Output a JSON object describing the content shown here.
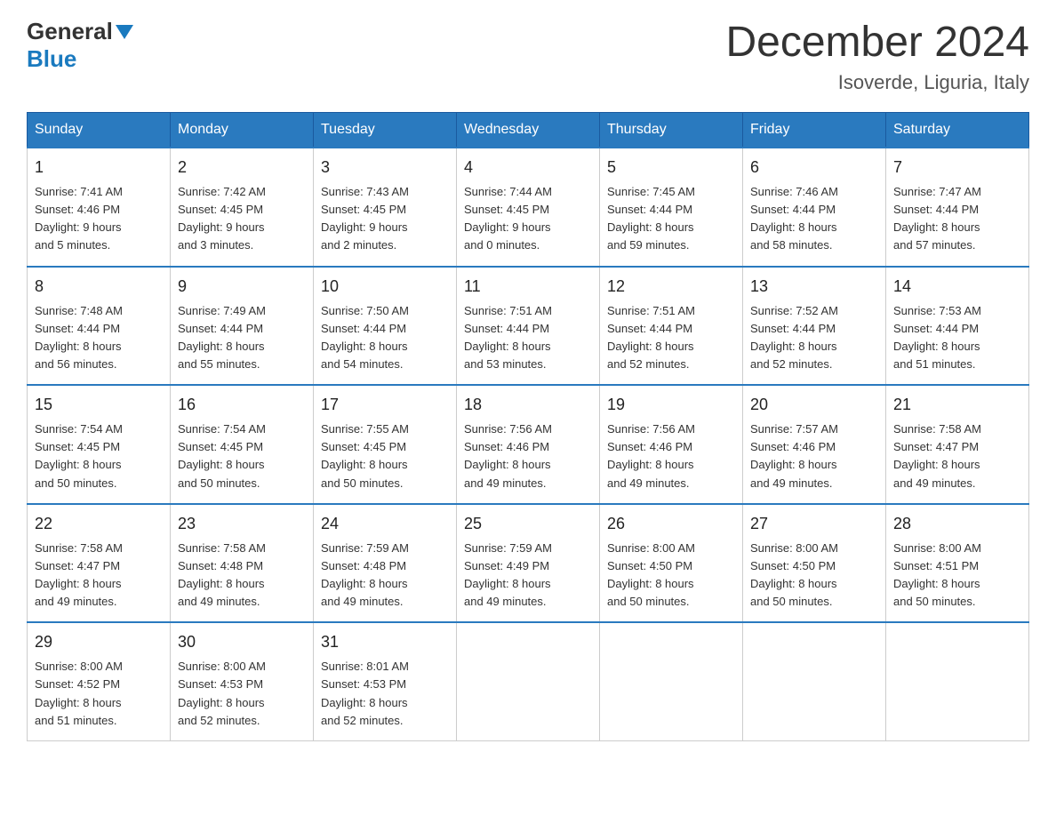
{
  "header": {
    "logo_general": "General",
    "logo_blue": "Blue",
    "title": "December 2024",
    "subtitle": "Isoverde, Liguria, Italy"
  },
  "days_of_week": [
    "Sunday",
    "Monday",
    "Tuesday",
    "Wednesday",
    "Thursday",
    "Friday",
    "Saturday"
  ],
  "weeks": [
    [
      {
        "day": "1",
        "sunrise": "7:41 AM",
        "sunset": "4:46 PM",
        "daylight": "9 hours and 5 minutes."
      },
      {
        "day": "2",
        "sunrise": "7:42 AM",
        "sunset": "4:45 PM",
        "daylight": "9 hours and 3 minutes."
      },
      {
        "day": "3",
        "sunrise": "7:43 AM",
        "sunset": "4:45 PM",
        "daylight": "9 hours and 2 minutes."
      },
      {
        "day": "4",
        "sunrise": "7:44 AM",
        "sunset": "4:45 PM",
        "daylight": "9 hours and 0 minutes."
      },
      {
        "day": "5",
        "sunrise": "7:45 AM",
        "sunset": "4:44 PM",
        "daylight": "8 hours and 59 minutes."
      },
      {
        "day": "6",
        "sunrise": "7:46 AM",
        "sunset": "4:44 PM",
        "daylight": "8 hours and 58 minutes."
      },
      {
        "day": "7",
        "sunrise": "7:47 AM",
        "sunset": "4:44 PM",
        "daylight": "8 hours and 57 minutes."
      }
    ],
    [
      {
        "day": "8",
        "sunrise": "7:48 AM",
        "sunset": "4:44 PM",
        "daylight": "8 hours and 56 minutes."
      },
      {
        "day": "9",
        "sunrise": "7:49 AM",
        "sunset": "4:44 PM",
        "daylight": "8 hours and 55 minutes."
      },
      {
        "day": "10",
        "sunrise": "7:50 AM",
        "sunset": "4:44 PM",
        "daylight": "8 hours and 54 minutes."
      },
      {
        "day": "11",
        "sunrise": "7:51 AM",
        "sunset": "4:44 PM",
        "daylight": "8 hours and 53 minutes."
      },
      {
        "day": "12",
        "sunrise": "7:51 AM",
        "sunset": "4:44 PM",
        "daylight": "8 hours and 52 minutes."
      },
      {
        "day": "13",
        "sunrise": "7:52 AM",
        "sunset": "4:44 PM",
        "daylight": "8 hours and 52 minutes."
      },
      {
        "day": "14",
        "sunrise": "7:53 AM",
        "sunset": "4:44 PM",
        "daylight": "8 hours and 51 minutes."
      }
    ],
    [
      {
        "day": "15",
        "sunrise": "7:54 AM",
        "sunset": "4:45 PM",
        "daylight": "8 hours and 50 minutes."
      },
      {
        "day": "16",
        "sunrise": "7:54 AM",
        "sunset": "4:45 PM",
        "daylight": "8 hours and 50 minutes."
      },
      {
        "day": "17",
        "sunrise": "7:55 AM",
        "sunset": "4:45 PM",
        "daylight": "8 hours and 50 minutes."
      },
      {
        "day": "18",
        "sunrise": "7:56 AM",
        "sunset": "4:46 PM",
        "daylight": "8 hours and 49 minutes."
      },
      {
        "day": "19",
        "sunrise": "7:56 AM",
        "sunset": "4:46 PM",
        "daylight": "8 hours and 49 minutes."
      },
      {
        "day": "20",
        "sunrise": "7:57 AM",
        "sunset": "4:46 PM",
        "daylight": "8 hours and 49 minutes."
      },
      {
        "day": "21",
        "sunrise": "7:58 AM",
        "sunset": "4:47 PM",
        "daylight": "8 hours and 49 minutes."
      }
    ],
    [
      {
        "day": "22",
        "sunrise": "7:58 AM",
        "sunset": "4:47 PM",
        "daylight": "8 hours and 49 minutes."
      },
      {
        "day": "23",
        "sunrise": "7:58 AM",
        "sunset": "4:48 PM",
        "daylight": "8 hours and 49 minutes."
      },
      {
        "day": "24",
        "sunrise": "7:59 AM",
        "sunset": "4:48 PM",
        "daylight": "8 hours and 49 minutes."
      },
      {
        "day": "25",
        "sunrise": "7:59 AM",
        "sunset": "4:49 PM",
        "daylight": "8 hours and 49 minutes."
      },
      {
        "day": "26",
        "sunrise": "8:00 AM",
        "sunset": "4:50 PM",
        "daylight": "8 hours and 50 minutes."
      },
      {
        "day": "27",
        "sunrise": "8:00 AM",
        "sunset": "4:50 PM",
        "daylight": "8 hours and 50 minutes."
      },
      {
        "day": "28",
        "sunrise": "8:00 AM",
        "sunset": "4:51 PM",
        "daylight": "8 hours and 50 minutes."
      }
    ],
    [
      {
        "day": "29",
        "sunrise": "8:00 AM",
        "sunset": "4:52 PM",
        "daylight": "8 hours and 51 minutes."
      },
      {
        "day": "30",
        "sunrise": "8:00 AM",
        "sunset": "4:53 PM",
        "daylight": "8 hours and 52 minutes."
      },
      {
        "day": "31",
        "sunrise": "8:01 AM",
        "sunset": "4:53 PM",
        "daylight": "8 hours and 52 minutes."
      },
      null,
      null,
      null,
      null
    ]
  ],
  "labels": {
    "sunrise": "Sunrise:",
    "sunset": "Sunset:",
    "daylight": "Daylight:"
  }
}
